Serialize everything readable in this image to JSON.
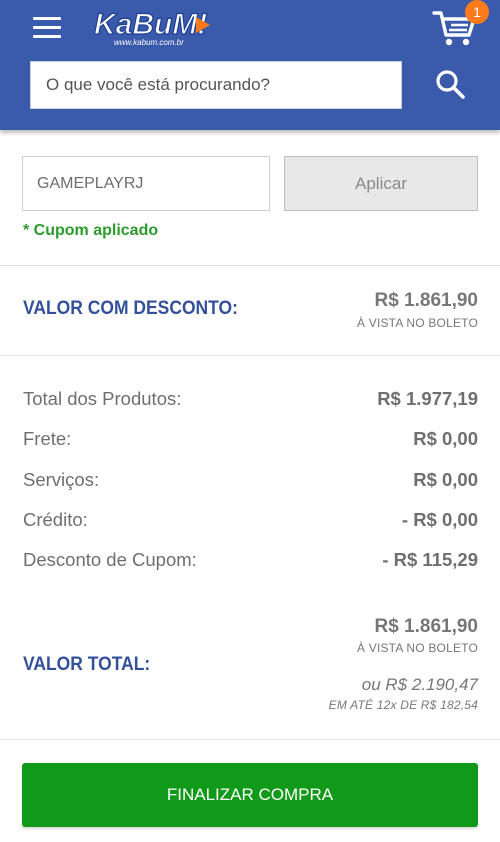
{
  "header": {
    "logo_text": "KaBuM!",
    "logo_subtext": "www.kabum.com.br",
    "cart_count": "1",
    "search_placeholder": "O que você está procurando?",
    "icons": {
      "menu": "hamburger-menu-icon",
      "cart": "shopping-cart-icon",
      "search": "magnifier-search-icon"
    },
    "colors": {
      "bar": "#3a5aab",
      "badge": "#ff7a1a"
    }
  },
  "coupon": {
    "code": "GAMEPLAYRJ",
    "apply_label": "Aplicar",
    "status": "* Cupom aplicado"
  },
  "discount": {
    "label": "VALOR COM DESCONTO:",
    "price": "R$ 1.861,90",
    "note": "À VISTA NO BOLETO"
  },
  "summary": [
    {
      "label": "Total dos Produtos:",
      "value": "R$ 1.977,19"
    },
    {
      "label": "Frete:",
      "value": "R$ 0,00"
    },
    {
      "label": "Serviços:",
      "value": "R$ 0,00"
    },
    {
      "label": "Crédito:",
      "value": "- R$ 0,00"
    },
    {
      "label": "Desconto de Cupom:",
      "value": "- R$ 115,29"
    }
  ],
  "total": {
    "label": "VALOR TOTAL:",
    "price": "R$ 1.861,90",
    "note": "À VISTA NO BOLETO",
    "installment_total": "ou R$ 2.190,47",
    "installment_note": "EM ATÉ 12x DE R$ 182,54"
  },
  "finalize_label": "FINALIZAR COMPRA",
  "colors": {
    "accent_blue": "#34509a",
    "success_green": "#2c9a2c",
    "button_green": "#119a19"
  }
}
